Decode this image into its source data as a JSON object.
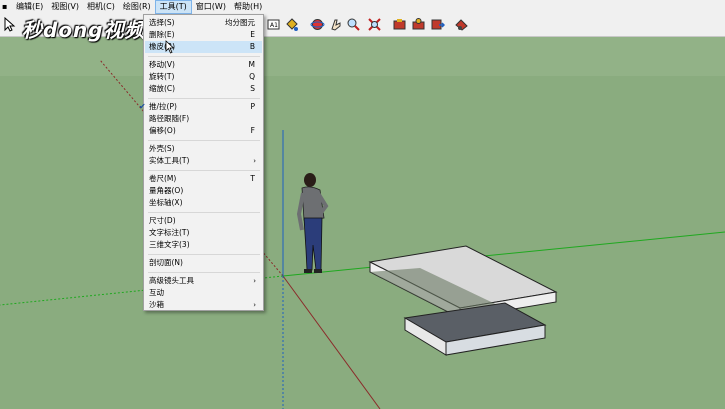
{
  "menubar": {
    "items": [
      "编辑(E)",
      "视图(V)",
      "相机(C)",
      "绘图(R)",
      "工具(T)",
      "窗口(W)",
      "帮助(H)"
    ],
    "active_index": 4
  },
  "watermark": {
    "text": "秒dong视频"
  },
  "tools_menu": {
    "items": [
      {
        "label": "选择(S)",
        "shortcut": "均分图元"
      },
      {
        "label": "删除(E)",
        "shortcut": "E"
      },
      {
        "label": "橡皮(B)",
        "shortcut": "B",
        "highlighted": true
      },
      {
        "label": "移动(V)",
        "shortcut": "M"
      },
      {
        "label": "旋转(T)",
        "shortcut": "Q"
      },
      {
        "label": "缩放(C)",
        "shortcut": "S"
      },
      {
        "label": "推/拉(P)",
        "shortcut": "P",
        "checked": true
      },
      {
        "label": "路径跟随(F)",
        "shortcut": ""
      },
      {
        "label": "偏移(O)",
        "shortcut": "F"
      },
      {
        "label": "外壳(S)",
        "shortcut": ""
      },
      {
        "label": "实体工具(T)",
        "shortcut": "",
        "submenu": true
      },
      {
        "label": "卷尺(M)",
        "shortcut": "T"
      },
      {
        "label": "量角器(O)",
        "shortcut": ""
      },
      {
        "label": "坐标轴(X)",
        "shortcut": ""
      },
      {
        "label": "尺寸(D)",
        "shortcut": ""
      },
      {
        "label": "文字标注(T)",
        "shortcut": ""
      },
      {
        "label": "三维文字(3)",
        "shortcut": ""
      },
      {
        "label": "剖切面(N)",
        "shortcut": ""
      },
      {
        "label": "高级镜头工具",
        "shortcut": "",
        "submenu": true
      },
      {
        "label": "互动",
        "shortcut": ""
      },
      {
        "label": "沙箱",
        "shortcut": "",
        "submenu": true
      }
    ],
    "check_glyph": "✔",
    "submenu_glyph": "›"
  },
  "colors": {
    "sky": "#dde8dd",
    "ground": "#8aac7f",
    "menu_highlight": "#cce4f7",
    "axis_green": "#1fa81f",
    "axis_red": "#c0392b",
    "axis_blue": "#1f5fc0"
  },
  "toolbar_icons": [
    "select-arrow-icon",
    "text-tool-icon",
    "paint-bucket-icon",
    "orbit-icon",
    "pan-icon",
    "zoom-icon",
    "zoom-extents-icon",
    "warehouse-icon",
    "component-icon",
    "share-model-icon",
    "extension-icon",
    "ruby-icon"
  ]
}
